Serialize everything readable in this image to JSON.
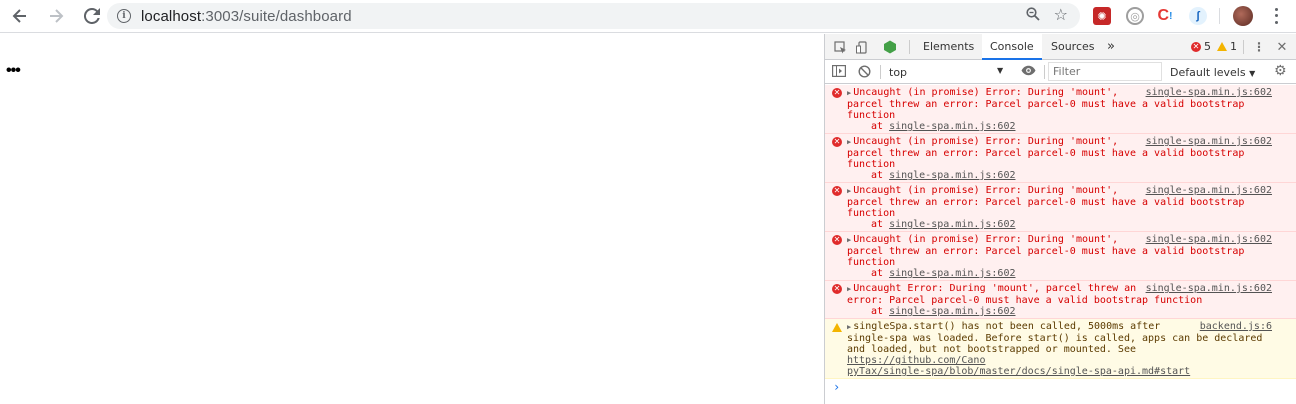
{
  "browser": {
    "url_host": "localhost",
    "url_rest": ":3003/suite/dashboard",
    "back_icon": "arrow-left-icon",
    "forward_icon": "arrow-right-icon",
    "reload_icon": "reload-icon"
  },
  "page": {
    "loader_text": "•••"
  },
  "devtools": {
    "tabs": [
      "Elements",
      "Console",
      "Sources"
    ],
    "more_tabs": "»",
    "error_count": "5",
    "warning_count": "1",
    "context": "top",
    "filter_placeholder": "Filter",
    "levels": "Default levels",
    "messages": [
      {
        "type": "error",
        "text": "Uncaught (in promise) Error: During 'mount',\nparcel threw an error: Parcel parcel-0 must have a valid bootstrap\nfunction",
        "source": "single-spa.min.js:602",
        "at": "single-spa.min.js:602"
      },
      {
        "type": "error",
        "text": "Uncaught (in promise) Error: During 'mount',\nparcel threw an error: Parcel parcel-0 must have a valid bootstrap\nfunction",
        "source": "single-spa.min.js:602",
        "at": "single-spa.min.js:602"
      },
      {
        "type": "error",
        "text": "Uncaught (in promise) Error: During 'mount',\nparcel threw an error: Parcel parcel-0 must have a valid bootstrap\nfunction",
        "source": "single-spa.min.js:602",
        "at": "single-spa.min.js:602"
      },
      {
        "type": "error",
        "text": "Uncaught (in promise) Error: During 'mount',\nparcel threw an error: Parcel parcel-0 must have a valid bootstrap\nfunction",
        "source": "single-spa.min.js:602",
        "at": "single-spa.min.js:602"
      },
      {
        "type": "error",
        "text": "Uncaught Error: During 'mount', parcel threw an\nerror: Parcel parcel-0 must have a valid bootstrap function",
        "source": "single-spa.min.js:602",
        "at": "single-spa.min.js:602"
      }
    ],
    "warning": {
      "text": "singleSpa.start() has not been called, 5000ms after\nsingle-spa was loaded. Before start() is called, apps can be declared\nand loaded, but not bootstrapped or mounted. See ",
      "link": "https://github.com/Cano\npyTax/single-spa/blob/master/docs/single-spa-api.md#start",
      "source": "backend.js:6"
    },
    "prompt": "›"
  },
  "colors": {
    "error_bg": "#fff0f0",
    "error_text": "#d60000",
    "warning_bg": "#fffbe5",
    "accent": "#1a73e8"
  }
}
